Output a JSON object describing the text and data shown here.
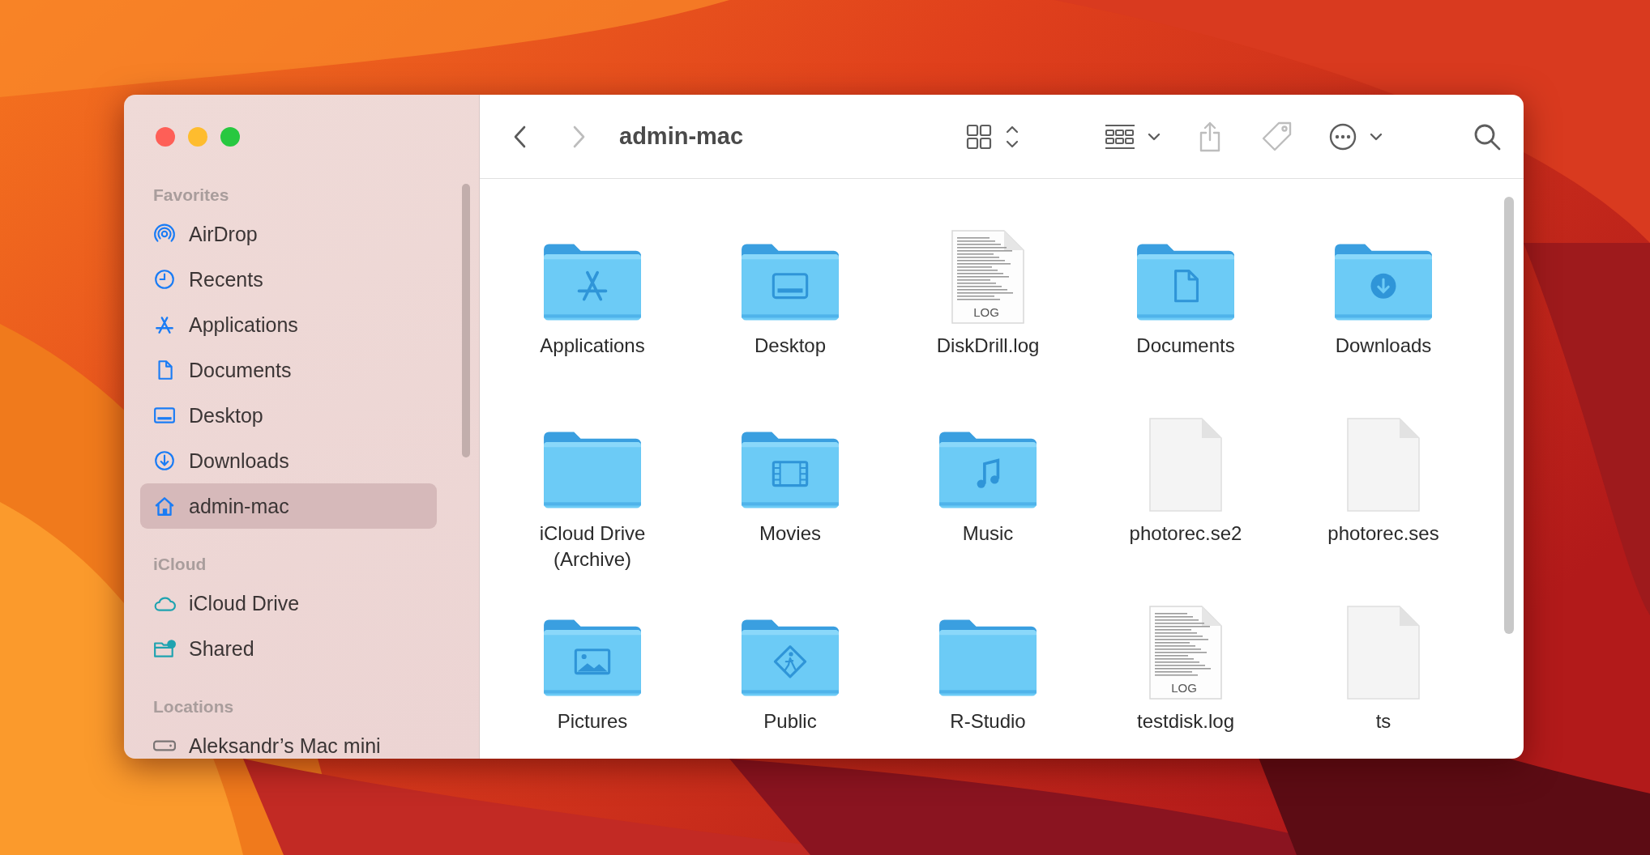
{
  "window": {
    "title": "admin-mac"
  },
  "toolbar": {
    "forward_disabled": true,
    "share_disabled": true,
    "tag_disabled": true
  },
  "sidebar": {
    "sections": [
      {
        "title": "Favorites",
        "items": [
          {
            "label": "AirDrop",
            "selected": false
          },
          {
            "label": "Recents",
            "selected": false
          },
          {
            "label": "Applications",
            "selected": false
          },
          {
            "label": "Documents",
            "selected": false
          },
          {
            "label": "Desktop",
            "selected": false
          },
          {
            "label": "Downloads",
            "selected": false
          },
          {
            "label": "admin-mac",
            "selected": true
          }
        ]
      },
      {
        "title": "iCloud",
        "items": [
          {
            "label": "iCloud Drive",
            "selected": false
          },
          {
            "label": "Shared",
            "selected": false
          }
        ]
      },
      {
        "title": "Locations",
        "items": [
          {
            "label": "Aleksandr’s Mac mini",
            "selected": false
          }
        ]
      }
    ]
  },
  "files": [
    {
      "name": "Applications",
      "kind": "folder"
    },
    {
      "name": "Desktop",
      "kind": "folder"
    },
    {
      "name": "DiskDrill.log",
      "kind": "log",
      "badge": "LOG"
    },
    {
      "name": "Documents",
      "kind": "folder"
    },
    {
      "name": "Downloads",
      "kind": "folder"
    },
    {
      "name": "iCloud Drive (Archive)",
      "kind": "folder"
    },
    {
      "name": "Movies",
      "kind": "folder"
    },
    {
      "name": "Music",
      "kind": "folder"
    },
    {
      "name": "photorec.se2",
      "kind": "file"
    },
    {
      "name": "photorec.ses",
      "kind": "file"
    },
    {
      "name": "Pictures",
      "kind": "folder"
    },
    {
      "name": "Public",
      "kind": "folder"
    },
    {
      "name": "R-Studio",
      "kind": "folder"
    },
    {
      "name": "testdisk.log",
      "kind": "log",
      "badge": "LOG"
    },
    {
      "name": "ts",
      "kind": "file"
    }
  ]
}
